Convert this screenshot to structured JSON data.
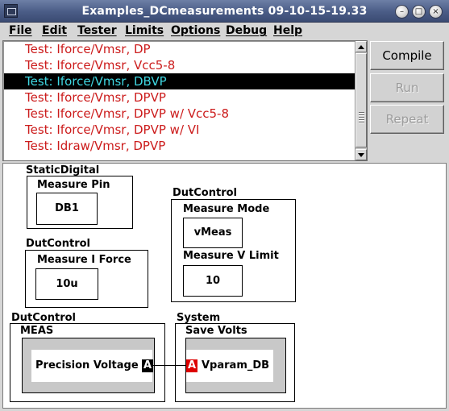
{
  "window": {
    "title": "Examples_DCmeasurements 09-10-15-19.33",
    "buttons": {
      "minimize": "–",
      "maximize": "□",
      "close": "×"
    }
  },
  "menu": {
    "items": [
      "File",
      "Edit",
      "Tester",
      "Limits",
      "Options",
      "Debug",
      "Help"
    ]
  },
  "tests": {
    "items": [
      "Test: Iforce/Vmsr, DP",
      "Test: Iforce/Vmsr, Vcc5-8",
      "Test: Iforce/Vmsr, DBVP",
      "Test: Iforce/Vmsr, DPVP",
      "Test: Iforce/Vmsr, DPVP w/ Vcc5-8",
      "Test: Iforce/Vmsr, DPVP w/ VI",
      "Test: Idraw/Vmsr, DPVP"
    ],
    "selected_index": 2
  },
  "actions": {
    "compile": "Compile",
    "run": "Run",
    "repeat": "Repeat"
  },
  "canvas": {
    "static_digital": {
      "group": "StaticDigital",
      "title": "Measure Pin",
      "value": "DB1"
    },
    "dut_measure_i_force": {
      "group": "DutControl",
      "title": "Measure I Force",
      "value": "10u"
    },
    "dut_measure_mode": {
      "group": "DutControl",
      "mode_title": "Measure Mode",
      "mode_value": "vMeas",
      "limit_title": "Measure V Limit",
      "limit_value": "10"
    },
    "dut_meas": {
      "group": "DutControl",
      "title": "MEAS",
      "content": "Precision Voltage",
      "port": "A"
    },
    "system_save": {
      "group": "System",
      "title": "Save Volts",
      "content": "Vparam_DB",
      "port": "A"
    }
  },
  "colors": {
    "test_text": "#cc1c1c",
    "selected_bg": "#000000",
    "selected_text": "#3fd7e2",
    "port_out": "#000000",
    "port_in": "#dd0000"
  }
}
